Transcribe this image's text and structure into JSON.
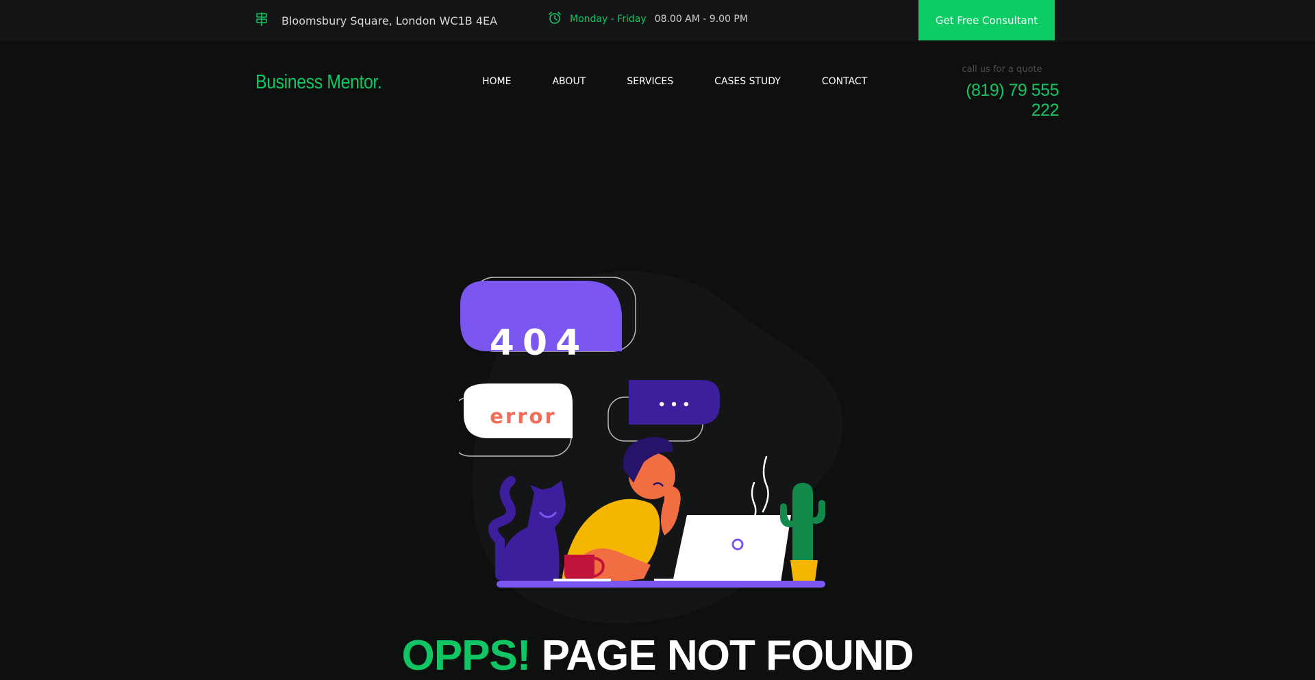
{
  "topbar": {
    "address": "Bloomsbury Square, London WC1B 4EA",
    "hours_days": "Monday - Friday",
    "hours_time": "08.00 AM - 9.00 PM",
    "cta_label": "Get Free Consultant",
    "address_icon": "signpost-icon",
    "hours_icon": "alarm-clock-icon"
  },
  "header": {
    "logo": "Business Mentor.",
    "nav": [
      "HOME",
      "ABOUT",
      "SERVICES",
      "CASES STUDY",
      "CONTACT"
    ],
    "quote_label": "call us for a quote",
    "phone": "(819) 79 555 222"
  },
  "hero": {
    "bubble_404": "404",
    "bubble_error": "error",
    "bubble_dots": "• • •",
    "headline_green": "OPPS!",
    "headline_white": "PAGE NOT FOUND"
  },
  "colors": {
    "accent": "#0ccc63",
    "background": "#0e0f0f",
    "topbar": "#141516",
    "purple": "#7b56f0",
    "error_text": "#f26b5b"
  }
}
